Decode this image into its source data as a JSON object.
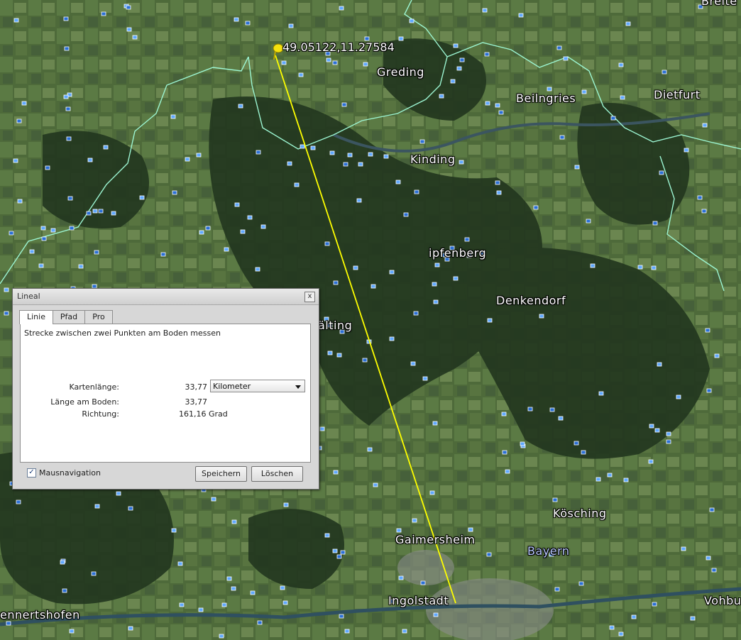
{
  "map": {
    "coordinate_label": "49.05122,11.27584",
    "places": [
      {
        "name": "Greding"
      },
      {
        "name": "Beilngries"
      },
      {
        "name": "Dietfurt"
      },
      {
        "name": "Kinding"
      },
      {
        "name": "ipfenberg"
      },
      {
        "name": "Denkendorf"
      },
      {
        "name": "älting"
      },
      {
        "name": "Kösching"
      },
      {
        "name": "Gaimersheim"
      },
      {
        "name": "Bayern"
      },
      {
        "name": "Ingolstadt"
      },
      {
        "name": "ennertshofen"
      },
      {
        "name": "Vohbu"
      },
      {
        "name": "Breite"
      }
    ],
    "colors": {
      "ruler_line": "#ffff00",
      "border": "#9cf5d2",
      "pin": "#f5e20e"
    }
  },
  "dialog": {
    "title": "Lineal",
    "close_label": "x",
    "tabs": [
      "Linie",
      "Pfad",
      "Pro"
    ],
    "active_tab": "Linie",
    "description": "Strecke zwischen zwei Punkten am Boden messen",
    "map_length_label": "Kartenlänge:",
    "map_length_value": "33,77",
    "unit_selected": "Kilometer",
    "ground_length_label": "Länge am Boden:",
    "ground_length_value": "33,77",
    "direction_label": "Richtung:",
    "direction_value": "161,16 Grad",
    "mouse_nav_label": "Mausnavigation",
    "mouse_nav_checked": true,
    "save_label": "Speichern",
    "delete_label": "Löschen"
  }
}
